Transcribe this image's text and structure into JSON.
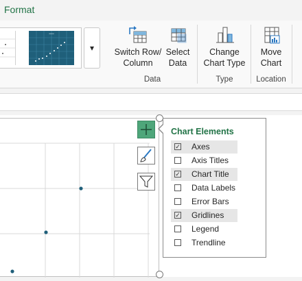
{
  "tabs": {
    "active": "Format"
  },
  "ribbon": {
    "more_styles_glyph": "▾",
    "buttons": {
      "switch_row_column": "Switch Row/\nColumn",
      "select_data": "Select\nData",
      "change_chart_type": "Change\nChart Type",
      "move_chart": "Move\nChart"
    },
    "groups": {
      "data": "Data",
      "type": "Type",
      "location": "Location"
    }
  },
  "side_buttons": {
    "chart_elements": "plus-icon",
    "chart_styles": "brush-icon",
    "chart_filters": "funnel-icon"
  },
  "chart_elements_panel": {
    "title": "Chart Elements",
    "items": [
      {
        "label": "Axes",
        "checked": true,
        "highlighted": true
      },
      {
        "label": "Axis Titles",
        "checked": false,
        "highlighted": false
      },
      {
        "label": "Chart Title",
        "checked": true,
        "highlighted": true
      },
      {
        "label": "Data Labels",
        "checked": false,
        "highlighted": false
      },
      {
        "label": "Error Bars",
        "checked": false,
        "highlighted": false
      },
      {
        "label": "Gridlines",
        "checked": true,
        "highlighted": true
      },
      {
        "label": "Legend",
        "checked": false,
        "highlighted": false
      },
      {
        "label": "Trendline",
        "checked": false,
        "highlighted": false
      }
    ],
    "check_glyph": "✓"
  },
  "colors": {
    "accent_green": "#217346",
    "active_button": "#4ea67a",
    "data_point": "#1f5f7a"
  }
}
